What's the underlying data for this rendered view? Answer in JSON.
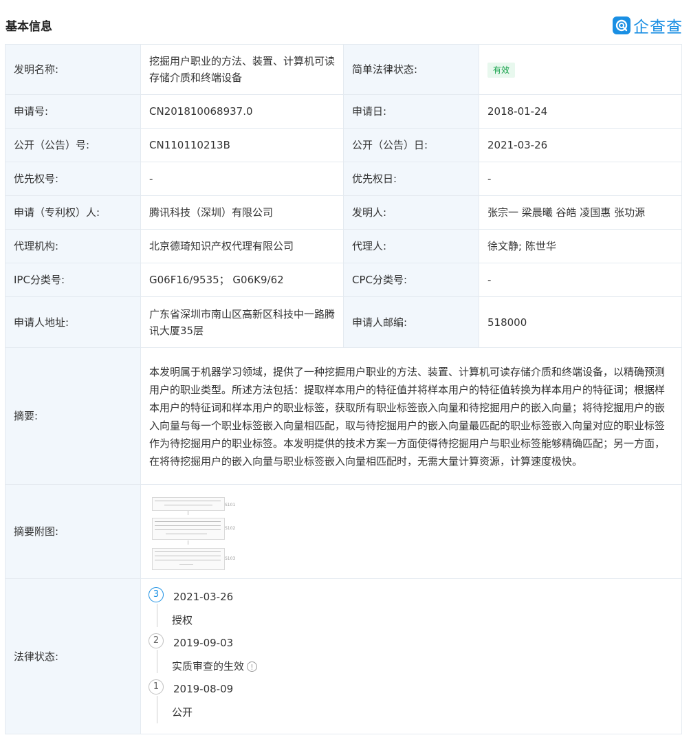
{
  "header": {
    "title": "基本信息",
    "logo_text": "企查查"
  },
  "rows": {
    "invention_name": {
      "label": "发明名称:",
      "value": "挖掘用户职业的方法、装置、计算机可读存储介质和终端设备"
    },
    "legal_status_simple": {
      "label": "简单法律状态:",
      "value": "有效",
      "color": "#18a24c"
    },
    "application_no": {
      "label": "申请号:",
      "value": "CN201810068937.0"
    },
    "application_date": {
      "label": "申请日:",
      "value": "2018-01-24"
    },
    "publication_no": {
      "label": "公开（公告）号:",
      "value": "CN110110213B"
    },
    "publication_date": {
      "label": "公开（公告）日:",
      "value": "2021-03-26"
    },
    "priority_no": {
      "label": "优先权号:",
      "value": "-"
    },
    "priority_date": {
      "label": "优先权日:",
      "value": "-"
    },
    "applicant": {
      "label": "申请（专利权）人:",
      "value": "腾讯科技（深圳）有限公司"
    },
    "inventor": {
      "label": "发明人:",
      "value": "张宗一 梁晨曦 谷皓 凌国惠 张功源"
    },
    "agency": {
      "label": "代理机构:",
      "value": "北京德琦知识产权代理有限公司"
    },
    "agent": {
      "label": "代理人:",
      "value": "徐文静; 陈世华"
    },
    "ipc": {
      "label": "IPC分类号:",
      "value": "G06F16/9535； G06K9/62"
    },
    "cpc": {
      "label": "CPC分类号:",
      "value": "-"
    },
    "address": {
      "label": "申请人地址:",
      "value": "广东省深圳市南山区高新区科技中一路腾讯大厦35层"
    },
    "postcode": {
      "label": "申请人邮编:",
      "value": "518000"
    },
    "abstract": {
      "label": "摘要:",
      "value": "本发明属于机器学习领域，提供了一种挖掘用户职业的方法、装置、计算机可读存储介质和终端设备，以精确预测用户的职业类型。所述方法包括：提取样本用户的特征值并将样本用户的特征值转换为样本用户的特征词；根据样本用户的特征词和样本用户的职业标签，获取所有职业标签嵌入向量和待挖掘用户的嵌入向量；将待挖掘用户的嵌入向量与每一个职业标签嵌入向量相匹配，取与待挖掘用户的嵌入向量最匹配的职业标签嵌入向量对应的职业标签作为待挖掘用户的职业标签。本发明提供的技术方案一方面使得待挖掘用户与职业标签能够精确匹配；另一方面，在将待挖掘用户的嵌入向量与职业标签嵌入向量相匹配时，无需大量计算资源，计算速度极快。"
    },
    "abstract_figure": {
      "label": "摘要附图:"
    },
    "legal_status": {
      "label": "法律状态:",
      "events": [
        {
          "num": "3",
          "date": "2021-03-26",
          "desc": "授权",
          "active": true
        },
        {
          "num": "2",
          "date": "2019-09-03",
          "desc": "实质审查的生效",
          "has_info": true
        },
        {
          "num": "1",
          "date": "2019-08-09",
          "desc": "公开"
        }
      ]
    }
  },
  "colors": {
    "accent": "#1a8fe3",
    "link": "#1a73c8",
    "label_bg": "#f2f7fc",
    "status_green": "#18a24c"
  }
}
